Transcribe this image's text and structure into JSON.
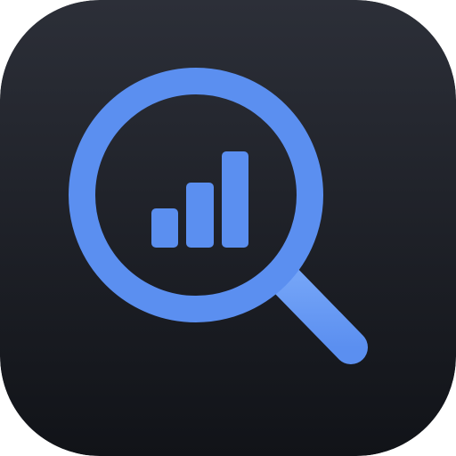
{
  "app_icon": {
    "icon": "magnifier-chart-icon",
    "background_top": "#2c2f38",
    "background_bottom": "#111318",
    "accent": "#5b8ff0",
    "accent_light": "#74a4f7",
    "elements": {
      "lens": "magnifier-lens-icon",
      "handle": "magnifier-handle-icon",
      "bars": "bar-chart-icon"
    }
  }
}
